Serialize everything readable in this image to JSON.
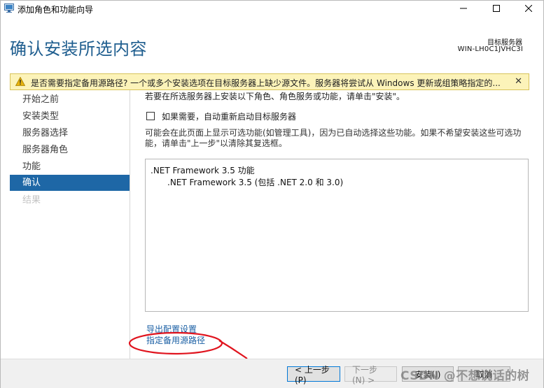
{
  "window": {
    "title": "添加角色和功能向导",
    "minimize_glyph": "—",
    "maximize_glyph": "☐",
    "close_glyph": "✕"
  },
  "header": {
    "title": "确认安装所选内容",
    "server_label": "目标服务器",
    "server_name": "WIN-LH0C1JVHC3I"
  },
  "warning": {
    "text": "是否需要指定备用源路径? 一个或多个安装选项在目标服务器上缺少源文件。服务器将尝试从 Windows 更新或组策略指定的...",
    "close_glyph": "✕",
    "icon": "warning-triangle-icon",
    "background": "#fcf3b9"
  },
  "sidebar": {
    "items": [
      {
        "label": "开始之前",
        "state": "normal"
      },
      {
        "label": "安装类型",
        "state": "normal"
      },
      {
        "label": "服务器选择",
        "state": "normal"
      },
      {
        "label": "服务器角色",
        "state": "normal"
      },
      {
        "label": "功能",
        "state": "normal"
      },
      {
        "label": "确认",
        "state": "active"
      },
      {
        "label": "结果",
        "state": "disabled"
      }
    ],
    "active_color": "#1e67a6"
  },
  "content": {
    "intro": "若要在所选服务器上安装以下角色、角色服务或功能，请单击\"安装\"。",
    "restart_checkbox_label": "如果需要，自动重新启动目标服务器",
    "restart_checked": false,
    "note": "可能会在此页面上显示可选功能(如管理工具)，因为已自动选择这些功能。如果不希望安装这些可选功能，请单击\"上一步\"以清除其复选框。",
    "features": {
      "parent": ".NET Framework 3.5 功能",
      "child": ".NET Framework 3.5 (包括 .NET 2.0 和 3.0)"
    },
    "links": {
      "export": "导出配置设置",
      "source": "指定备用源路径"
    }
  },
  "footer": {
    "prev": "< 上一步(P)",
    "next": "下一步(N) >",
    "install": "安装(I)",
    "cancel": "取消"
  },
  "watermark": "CSDN @不想说话的树",
  "colors": {
    "title_blue": "#1f5e8f",
    "link_blue": "#1a5fa4",
    "annotation_red": "#e0141e"
  }
}
